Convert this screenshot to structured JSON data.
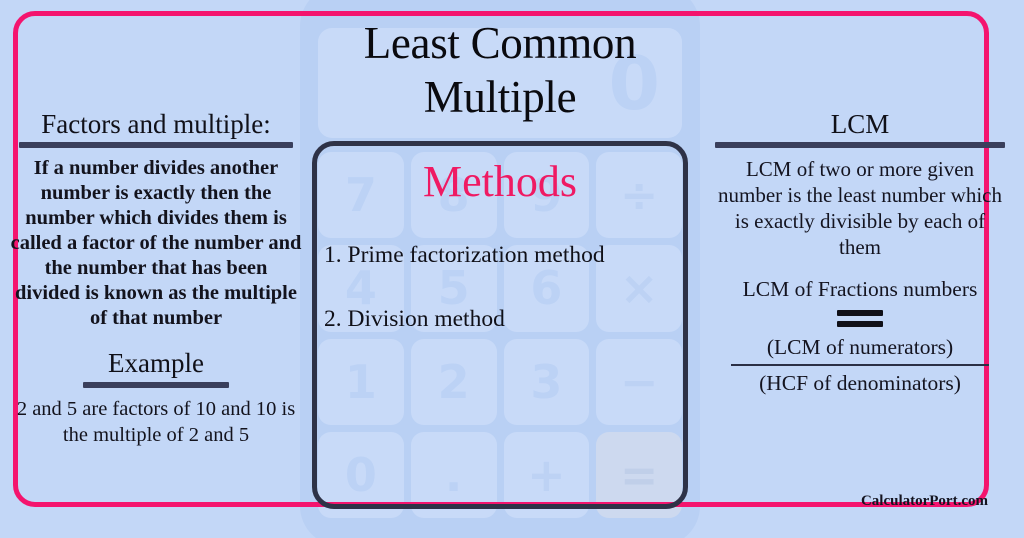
{
  "title": "Least Common Multiple",
  "colors": {
    "frame_pink": "#f4146e",
    "background_blue": "#c3d7f7",
    "accent_pink": "#ef1a63",
    "rule_navy": "#3a3f5c",
    "calc_border": "#2e3247"
  },
  "left": {
    "heading": "Factors and multiple:",
    "body": "If a number divides another number is exactly then the number which divides them is called a factor of the number and the number that has been divided is known as the multiple of that number",
    "example_heading": "Example",
    "example_body": "2 and 5 are factors of 10 and 10 is the multiple of 2 and 5"
  },
  "center": {
    "methods_heading": "Methods",
    "methods": [
      "1. Prime factorization method",
      "2. Division method"
    ]
  },
  "right": {
    "heading": "LCM",
    "body": "LCM of two or more given number is the least number which is exactly divisible by each of them",
    "fraction_label": "LCM of Fractions numbers",
    "equals": "=",
    "numerator": "(LCM of numerators)",
    "denominator": "(HCF of denominators)"
  },
  "brand": "CalculatorPort.com",
  "watermark": {
    "display_value": "0",
    "keys": [
      "7",
      "8",
      "9",
      "÷",
      "4",
      "5",
      "6",
      "×",
      "1",
      "2",
      "3",
      "−",
      "0",
      ".",
      "+",
      "="
    ]
  }
}
